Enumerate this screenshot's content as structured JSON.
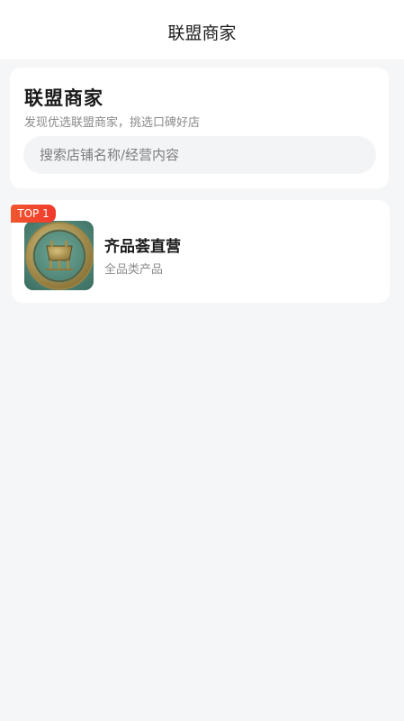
{
  "nav": {
    "title": "联盟商家"
  },
  "header": {
    "title": "联盟商家",
    "subtitle": "发现优选联盟商家，挑选口碑好店"
  },
  "search": {
    "placeholder": "搜索店铺名称/经营内容",
    "value": ""
  },
  "merchants": [
    {
      "rank_badge": "TOP 1",
      "name": "齐品荟直营",
      "category": "全品类产品",
      "logo_icon": "bronze-ding-seal-logo-icon"
    }
  ],
  "colors": {
    "badge": "#f13a2b",
    "background": "#f5f6f8",
    "card": "#ffffff"
  }
}
